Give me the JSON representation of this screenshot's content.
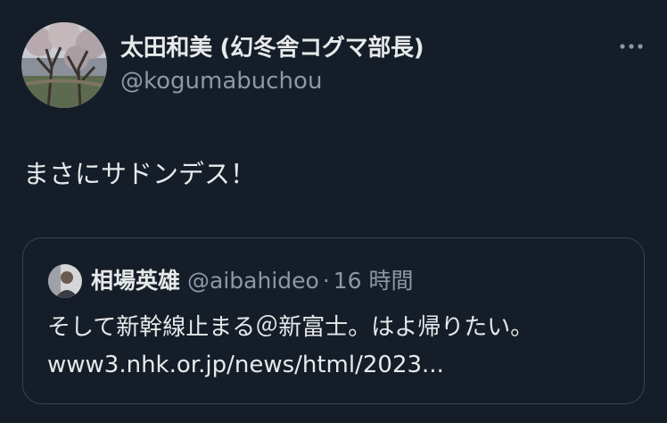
{
  "author": {
    "display_name": "太田和美 (幻冬舎コグマ部長)",
    "handle": "@kogumabuchou"
  },
  "tweet": {
    "text": "まさにサドンデス！"
  },
  "quote": {
    "display_name": "相場英雄",
    "handle": "@aibahideo",
    "separator": "·",
    "time": "16 時間",
    "text": "そして新幹線止まる＠新富士。はよ帰りたい。",
    "link": "www3.nhk.or.jp/news/html/2023..."
  },
  "icons": {
    "more": "more-horizontal-icon"
  },
  "colors": {
    "background": "#151d28",
    "primary_text": "#e7e9ea",
    "secondary_text": "#8b98a5",
    "border": "#38444d"
  }
}
